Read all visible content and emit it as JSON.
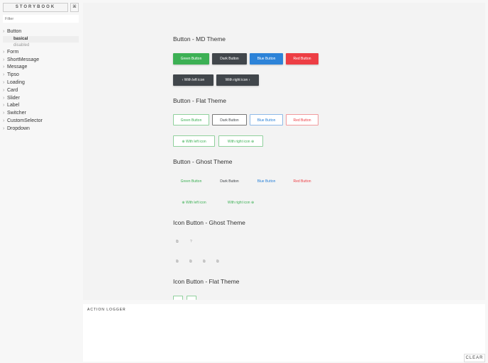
{
  "sidebar": {
    "brand": "STORYBOOK",
    "shortcut": "⌘",
    "filter_placeholder": "Filter",
    "items": [
      "Button",
      "Form",
      "ShortMessage",
      "Message",
      "Tipso",
      "Loading",
      "Card",
      "Slider",
      "Label",
      "Switcher",
      "CustomSelector",
      "Dropdown"
    ],
    "sub": [
      "basical",
      "disabled"
    ]
  },
  "sections": {
    "md": "Button - MD Theme",
    "flat": "Button - Flat Theme",
    "ghost": "Button - Ghost Theme",
    "iconGhost": "Icon Button - Ghost Theme",
    "iconFlat": "Icon Button - Flat Theme"
  },
  "buttons": {
    "green": "Green Button",
    "dark": "Dark Button",
    "blue": "Blue Button",
    "red": "Red Button",
    "left": "With left icon",
    "right": "With right icon"
  },
  "colors": {
    "green": "#3cb054",
    "dark": "#41464b",
    "blue": "#2d83d8",
    "red": "#ed3e44"
  },
  "logger": {
    "title": "ACTION LOGGER",
    "clear": "CLEAR"
  }
}
